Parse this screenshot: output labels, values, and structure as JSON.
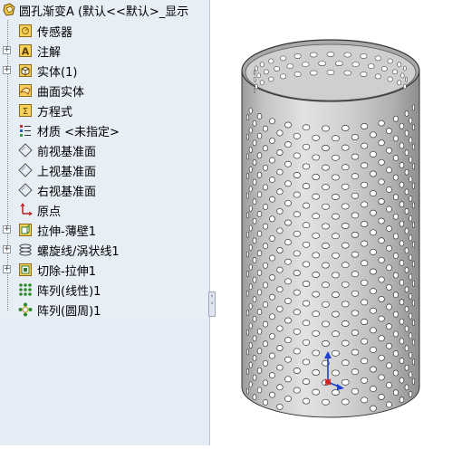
{
  "tree": {
    "root_label": "圆孔渐变A (默认<<默认>_显示",
    "items": [
      {
        "label": "传感器",
        "icon": "sensor-icon"
      },
      {
        "label": "注解",
        "icon": "annotation-icon"
      },
      {
        "label": "实体(1)",
        "icon": "solid-bodies-icon"
      },
      {
        "label": "曲面实体",
        "icon": "surface-bodies-icon"
      },
      {
        "label": "方程式",
        "icon": "equations-icon"
      },
      {
        "label": "材质 <未指定>",
        "icon": "material-icon"
      },
      {
        "label": "前视基准面",
        "icon": "plane-icon"
      },
      {
        "label": "上视基准面",
        "icon": "plane-icon"
      },
      {
        "label": "右视基准面",
        "icon": "plane-icon"
      },
      {
        "label": "原点",
        "icon": "origin-icon"
      },
      {
        "label": "拉伸-薄壁1",
        "icon": "extrude-icon"
      },
      {
        "label": "螺旋线/涡状线1",
        "icon": "helix-icon"
      },
      {
        "label": "切除-拉伸1",
        "icon": "cut-extrude-icon"
      },
      {
        "label": "阵列(线性)1",
        "icon": "linear-pattern-icon"
      },
      {
        "label": "阵列(圆周)1",
        "icon": "circular-pattern-icon"
      }
    ]
  },
  "colors": {
    "tree_bg": "#e8eef6",
    "folder_yellow": "#f3c84b",
    "feature_green": "#3e8e3e",
    "axis_blue": "#1f3fd0",
    "axis_red": "#d02020"
  },
  "viewport": {
    "model": "perforated-cylinder",
    "triad": "origin-triad-icon"
  }
}
